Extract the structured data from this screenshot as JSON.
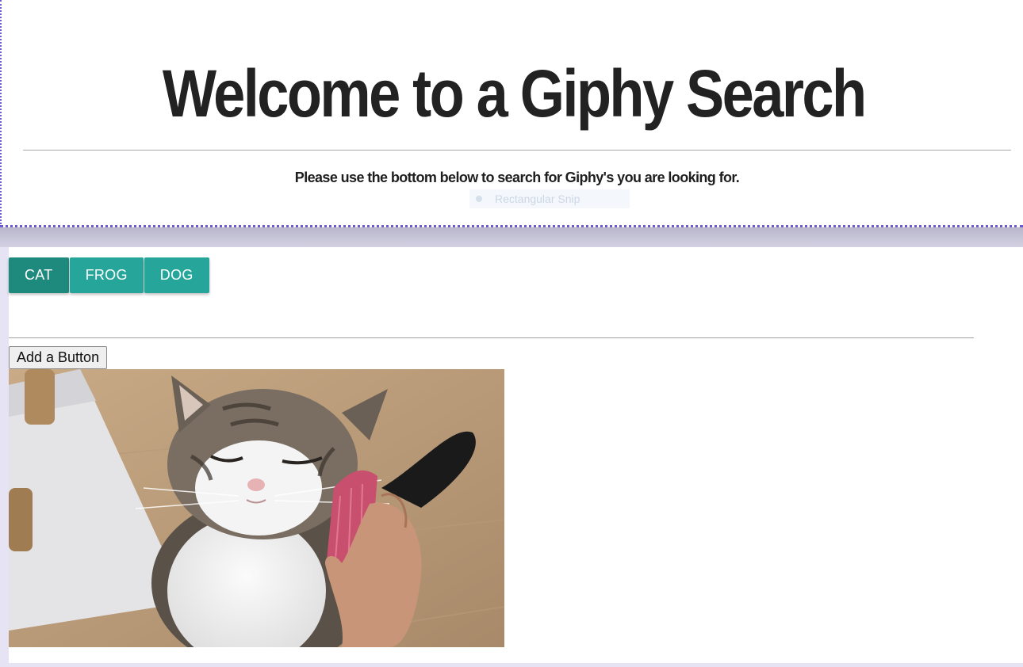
{
  "header": {
    "title": "Welcome to a Giphy Search",
    "subtitle": "Please use the bottom below to search for Giphy's you are looking for.",
    "snip_tooltip": "Rectangular Snip"
  },
  "topic_buttons": [
    "CAT",
    "FROG",
    "DOG"
  ],
  "active_topic": "CAT",
  "add_button_label": "Add a Button",
  "colors": {
    "button": "#26a69a",
    "button_active": "#1e8a7e",
    "snip_border": "#6a5acd",
    "background": "#e6e4f4"
  },
  "gif": {
    "subject": "cat being brushed"
  }
}
